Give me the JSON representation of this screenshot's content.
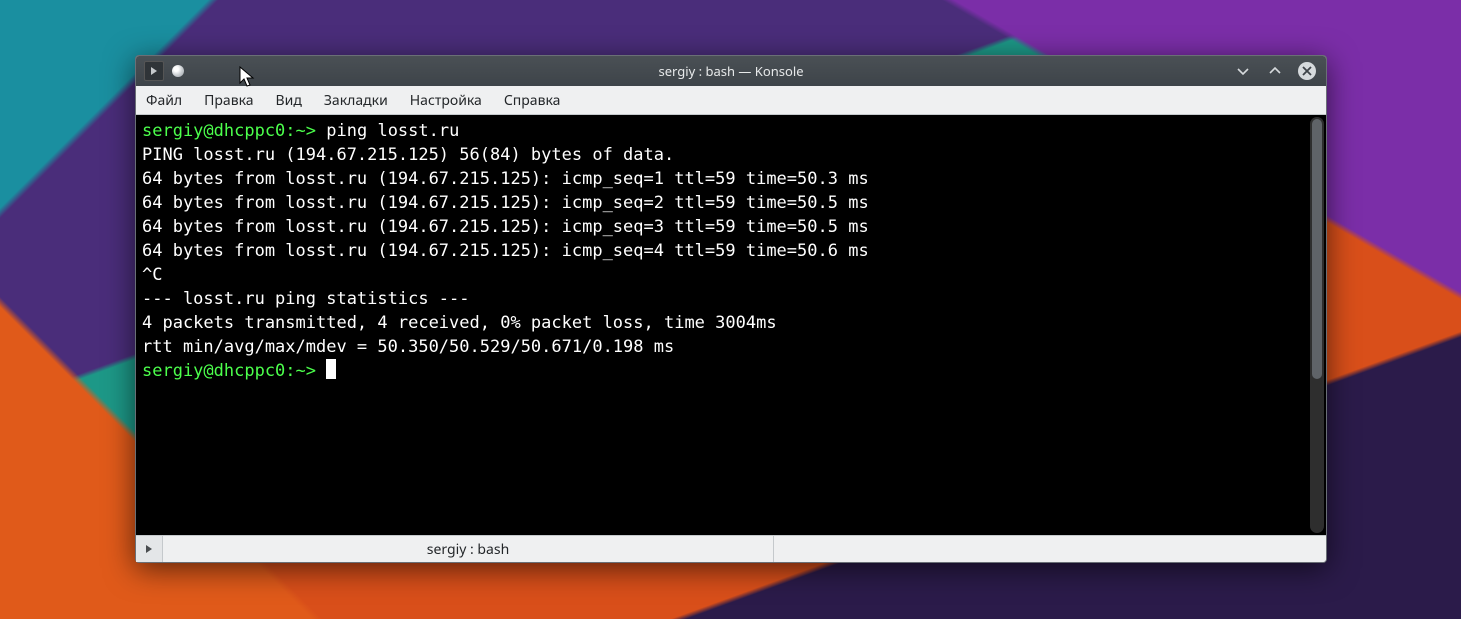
{
  "window": {
    "title": "sergiy : bash — Konsole"
  },
  "menubar": {
    "items": [
      "Файл",
      "Правка",
      "Вид",
      "Закладки",
      "Настройка",
      "Справка"
    ]
  },
  "terminal": {
    "prompt1_user": "sergiy@dhcppc0",
    "prompt1_sep": ":",
    "prompt1_path": "~",
    "prompt1_gt": ">",
    "cmd1": " ping losst.ru",
    "lines": [
      "PING losst.ru (194.67.215.125) 56(84) bytes of data.",
      "64 bytes from losst.ru (194.67.215.125): icmp_seq=1 ttl=59 time=50.3 ms",
      "64 bytes from losst.ru (194.67.215.125): icmp_seq=2 ttl=59 time=50.5 ms",
      "64 bytes from losst.ru (194.67.215.125): icmp_seq=3 ttl=59 time=50.5 ms",
      "64 bytes from losst.ru (194.67.215.125): icmp_seq=4 ttl=59 time=50.6 ms",
      "^C",
      "--- losst.ru ping statistics ---",
      "4 packets transmitted, 4 received, 0% packet loss, time 3004ms",
      "rtt min/avg/max/mdev = 50.350/50.529/50.671/0.198 ms"
    ],
    "prompt2_user": "sergiy@dhcppc0",
    "prompt2_sep": ":",
    "prompt2_path": "~",
    "prompt2_gt": ">"
  },
  "tab": {
    "label": "sergiy : bash"
  }
}
